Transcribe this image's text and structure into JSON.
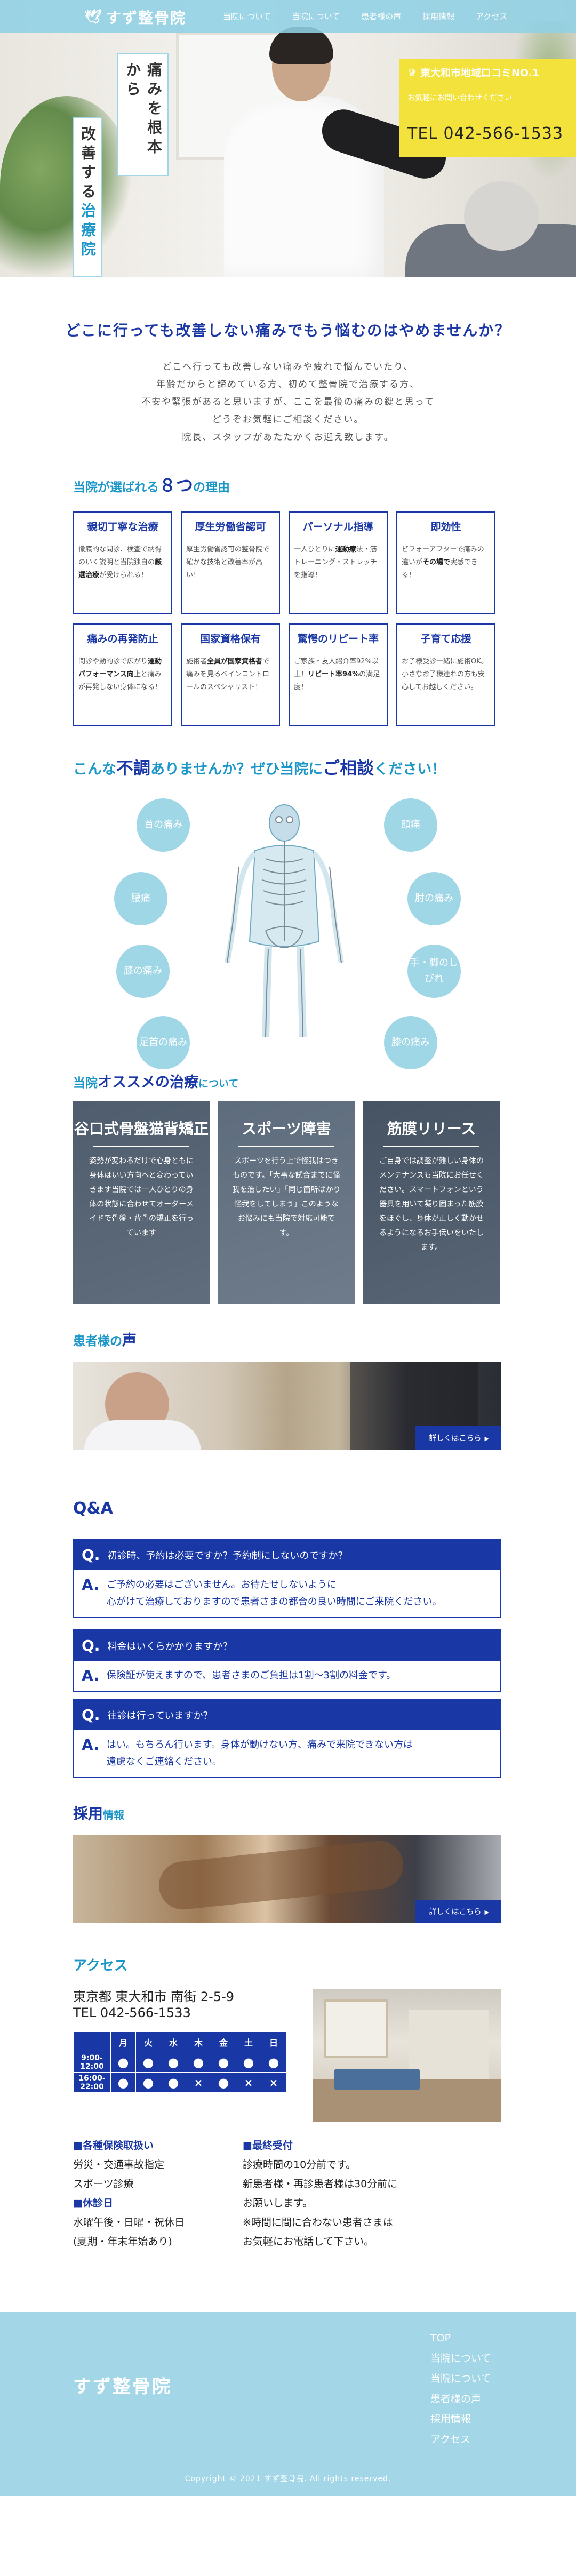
{
  "header": {
    "logo": "すず整骨院",
    "nav": [
      "当院について",
      "当院について",
      "患者様の声",
      "採用情報",
      "アクセス"
    ]
  },
  "hero": {
    "vertical_1": "痛みを根本から",
    "vertical_2_pre": "改善する",
    "vertical_2_hl": "治療院",
    "rank": "東大和市地域口コミNO.1",
    "contact_label": "お気軽にお問い合わせください",
    "tel": "TEL 042-566-1533"
  },
  "intro": {
    "title": "どこに行っても改善しない痛みでもう悩むのはやめませんか？",
    "lines": [
      "どこへ行っても改善しない痛みや疲れで悩んでいたり、",
      "年齢だからと諦めている方、初めて整骨院で治療する方、",
      "不安や緊張があると思いますが、ここを最後の痛みの鍵と思って",
      "どうぞお気軽にご相談ください。",
      "院長、スタッフがあたたかくお迎え致します。"
    ]
  },
  "reasons": {
    "head_pre": "当院が選ばれる",
    "head_num": "８つ",
    "head_post": "の理由",
    "items": [
      {
        "title": "親切丁寧な治療",
        "desc": "徹底的な問診、検査で納得のいく説明と当院独自の",
        "bold": "厳選治療",
        "desc2": "が受けられる！"
      },
      {
        "title": "厚生労働省認可",
        "desc": "厚生労働省認可の整骨院で確かな技術と改善率が高い！",
        "bold": "",
        "desc2": ""
      },
      {
        "title": "パーソナル指導",
        "desc": "一人ひとりに",
        "bold": "運動療",
        "desc2": "法・筋トレーニング・ストレッチを指導！"
      },
      {
        "title": "即効性",
        "desc": "ビフォーアフターで痛みの違いが",
        "bold": "その場で",
        "desc2": "実感できる！"
      },
      {
        "title": "痛みの再発防止",
        "desc": "問診や動的診で広がり",
        "bold": "運動パフォーマンス向上",
        "desc2": "と痛みが再発しない身体になる！"
      },
      {
        "title": "国家資格保有",
        "desc": "施術者",
        "bold": "全員が国家資格者",
        "desc2": "で痛みを見るベインコントロールのスペシャリスト！"
      },
      {
        "title": "驚愕のリピート率",
        "desc": "ご家族・友人紹介率92%以上！",
        "bold": "リピート率94%",
        "desc2": "の満足度！"
      },
      {
        "title": "子育て応援",
        "desc": "お子様受診一緒に施術OK。小さなお子様連れの方も安心してお越しください。",
        "bold": "",
        "desc2": ""
      }
    ]
  },
  "pains": {
    "head_a": "こんな",
    "head_b": "不調",
    "head_c": "ありませんか？ぜひ当院に",
    "head_d": "ご相談",
    "head_e": "ください！",
    "left": [
      "首の痛み",
      "腰痛",
      "膝の痛み",
      "足首の痛み"
    ],
    "right": [
      "頭痛",
      "肘の痛み",
      "手・脚のしびれ",
      "膝の痛み"
    ]
  },
  "treat": {
    "head_pre": "当院",
    "head_main": "オススメの治療",
    "head_post": "について",
    "cards": [
      {
        "title": "谷口式骨盤猫背矯正",
        "desc": "姿勢が変わるだけで心身ともに身体はいい方向へと変わっていきます当院では一人ひとりの身体の状態に合わせてオーダーメイドで骨盤・背骨の矯正を行っています"
      },
      {
        "title": "スポーツ障害",
        "desc": "スポーツを行う上で怪我はつきものです。「大事な試合までに怪我を治したい」「同じ箇所ばかり怪我をしてしまう」このようなお悩みにも当院で対応可能です。"
      },
      {
        "title": "筋膜リリース",
        "desc": "ご自身では調整が難しい身体のメンテナンスも当院にお任せください。スマートフォンという器具を用いて凝り固まった筋膜をほぐし、身体が正しく動かせるようになるお手伝いをいたします。"
      }
    ]
  },
  "voice": {
    "head_pre": "患者様の",
    "head_main": "声",
    "more": "詳しくはこちら"
  },
  "qa": {
    "head": "Q&A",
    "items": [
      {
        "q": "初診時、予約は必要ですか？予約制にしないのですか？",
        "a1": "ご予約の必要はございません。お待たせしないように",
        "a2": "心がけて治療しておりますので患者さまの都合の良い時間にご来院ください。"
      },
      {
        "q": "料金はいくらかかりますか？",
        "a1": "保険証が使えますので、患者さまのご負担は1割〜3割の料金です。",
        "a2": ""
      },
      {
        "q": "往診は行っていますか？",
        "a1": "はい。もちろん行います。身体が動けない方、痛みで来院できない方は",
        "a2": "遠慮なくご連絡ください。"
      }
    ]
  },
  "recruit": {
    "head_pre": "採用",
    "head_post": "情報",
    "more": "詳しくはこちら"
  },
  "access": {
    "head": "アクセス",
    "address": "東京都 東大和市 南街 2-5-9",
    "tel": "TEL 042-566-1533",
    "days": [
      "月",
      "火",
      "水",
      "木",
      "金",
      "土",
      "日"
    ],
    "rows": [
      {
        "time": "9:00-12:00",
        "cells": [
          "●",
          "●",
          "●",
          "●",
          "●",
          "●",
          "●"
        ]
      },
      {
        "time": "16:00-22:00",
        "cells": [
          "●",
          "●",
          "●",
          "×",
          "●",
          "×",
          "×"
        ]
      }
    ],
    "insurance_head": "■各種保険取扱い",
    "insurance_lines": [
      "労災・交通事故指定",
      "スポーツ診療"
    ],
    "closed_head": "■休診日",
    "closed_lines": [
      "水曜午後・日曜・祝休日",
      "(夏期・年末年始あり)"
    ],
    "reception_head": "■最終受付",
    "reception_lines": [
      "診療時間の10分前です。",
      "新患者様・再診患者様は30分前に",
      "お願いします。",
      "※時間に間に合わない患者さまは",
      "お気軽にお電話して下さい。"
    ]
  },
  "footer": {
    "logo": "すず整骨院",
    "nav": [
      "TOP",
      "当院について",
      "当院について",
      "患者様の声",
      "採用情報",
      "アクセス"
    ],
    "copyright": "Copyright © 2021 すず整骨院. All rights reserved."
  },
  "colors": {
    "primary": "#1a37a6",
    "accent": "#1b96c8",
    "sky": "#a3d7e7",
    "yellow": "#f3e23b"
  }
}
